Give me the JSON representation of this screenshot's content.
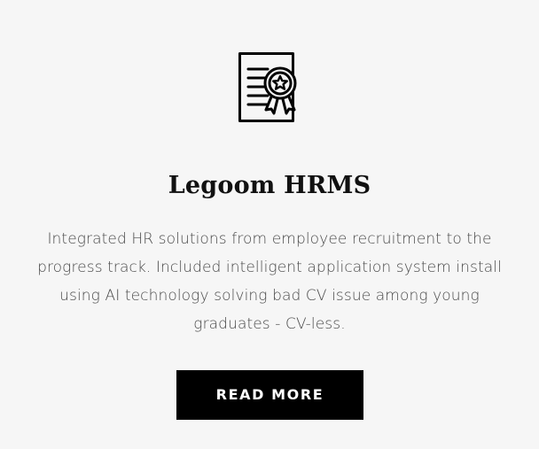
{
  "card": {
    "icon": "certificate-award-icon",
    "title": "Legoom HRMS",
    "description": "Integrated HR solutions from employee recruitment to the progress track. Included intelligent application system install using AI technology solving bad CV issue among young graduates - CV-less.",
    "button_label": "READ MORE"
  },
  "colors": {
    "background": "#f6f6f6",
    "title": "#111111",
    "text": "#4a4a4a",
    "button_bg": "#000000",
    "button_text": "#ffffff"
  }
}
